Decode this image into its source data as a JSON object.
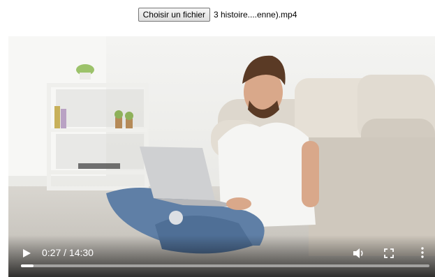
{
  "file_input": {
    "button_label": "Choisir un fichier",
    "file_name": "3 histoire....enne).mp4"
  },
  "player": {
    "time_display": "0:27 / 14:30",
    "progress_fraction": 0.031
  }
}
